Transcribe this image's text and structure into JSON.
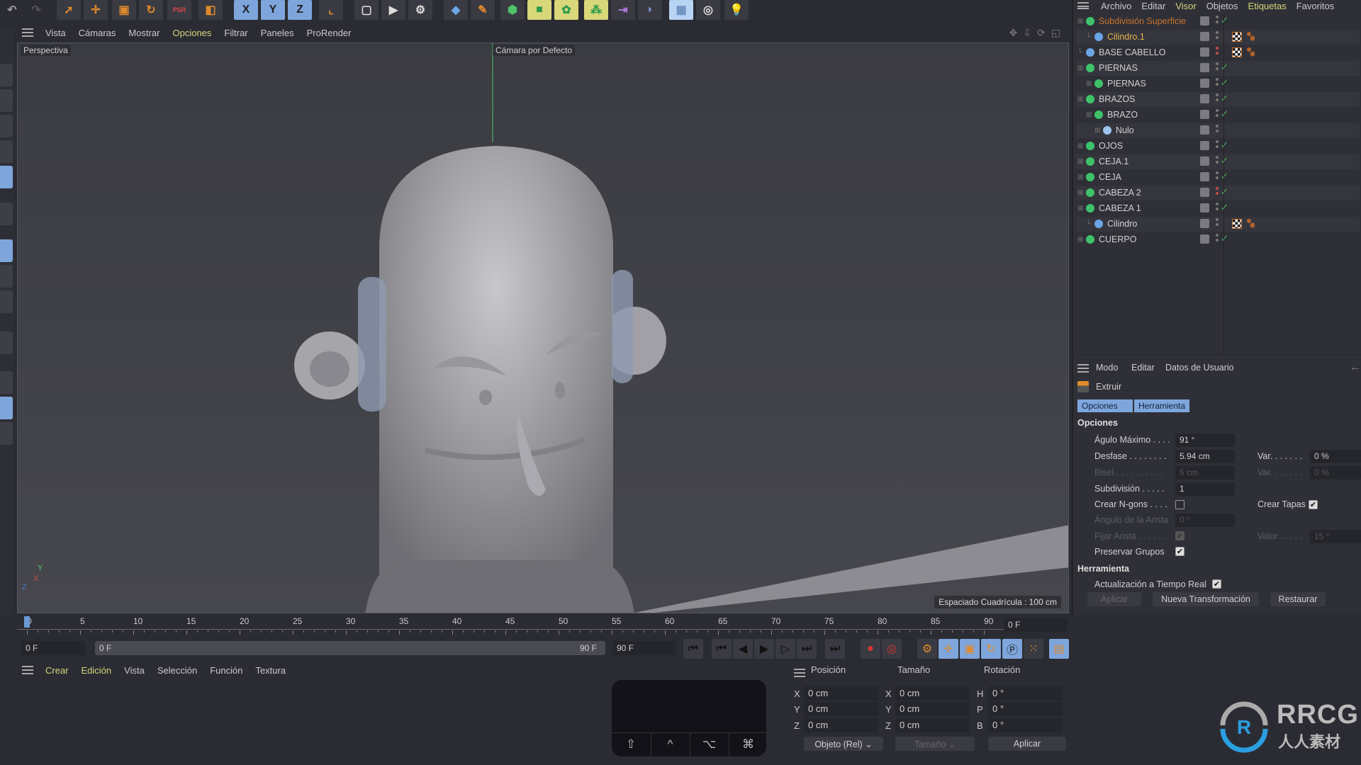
{
  "toolbar": {
    "icons": [
      "undo-icon",
      "redo-icon",
      "live-selection-icon",
      "move-icon",
      "scale-icon",
      "rotate-icon",
      "psr-icon",
      "object-mode-icon",
      "x-axis-lock-icon",
      "y-axis-lock-icon",
      "z-axis-lock-icon",
      "coordinate-system-icon",
      "render-view-icon",
      "render-picture-icon",
      "render-settings-icon",
      "cube-icon",
      "pen-icon",
      "subdivision-icon",
      "extrude-generator-icon",
      "cloner-icon",
      "mograph-icon",
      "deformer-icon",
      "bend-icon",
      "floor-icon",
      "camera-icon",
      "light-icon"
    ],
    "axis_labels": [
      "X",
      "Y",
      "Z"
    ]
  },
  "viewport": {
    "menu": [
      "Vista",
      "Cámaras",
      "Mostrar",
      "Opciones",
      "Filtrar",
      "Paneles",
      "ProRender"
    ],
    "active_menu": "Opciones",
    "view_name": "Perspectiva",
    "camera_name": "Cámara por Defecto",
    "grid_spacing": "Espaciado Cuadrícula : 100 cm",
    "axis": {
      "x": "X",
      "y": "Y",
      "z": "Z"
    }
  },
  "timeline": {
    "ticks": [
      "0",
      "5",
      "10",
      "15",
      "20",
      "25",
      "30",
      "35",
      "40",
      "45",
      "50",
      "55",
      "60",
      "65",
      "70",
      "75",
      "80",
      "85",
      "90"
    ],
    "current_frame": "0 F",
    "start_field": "0 F",
    "range_start": "0 F",
    "range_end": "90 F",
    "end_field": "90 F"
  },
  "material_menu": [
    "Crear",
    "Edición",
    "Vista",
    "Selección",
    "Función",
    "Textura"
  ],
  "keypad": {
    "keys": [
      "⇧",
      "^",
      "⌥",
      "⌘"
    ]
  },
  "coords": {
    "headers": [
      "Posición",
      "Tamaño",
      "Rotación"
    ],
    "position": [
      {
        "axis": "X",
        "value": "0 cm"
      },
      {
        "axis": "Y",
        "value": "0 cm"
      },
      {
        "axis": "Z",
        "value": "0 cm"
      }
    ],
    "size": [
      {
        "axis": "X",
        "value": "0 cm"
      },
      {
        "axis": "Y",
        "value": "0 cm"
      },
      {
        "axis": "Z",
        "value": "0 cm"
      }
    ],
    "rotation": [
      {
        "axis": "H",
        "value": "0 °"
      },
      {
        "axis": "P",
        "value": "0 °"
      },
      {
        "axis": "B",
        "value": "0 °"
      }
    ],
    "mode_select": "Objeto (Rel)",
    "size_select": "Tamaño",
    "apply": "Aplicar"
  },
  "object_manager": {
    "menu": [
      "Archivo",
      "Editar",
      "Visor",
      "Objetos",
      "Etiquetas",
      "Favoritos"
    ],
    "objects": [
      {
        "name": "Subdivisión Superficie",
        "indent": 0,
        "type": "generator",
        "color": "#c8732c",
        "check": true,
        "red": false,
        "tags": false
      },
      {
        "name": "Cilindro.1",
        "indent": 1,
        "type": "polygon",
        "color": "#e7b04a",
        "check": false,
        "red": false,
        "tags": true
      },
      {
        "name": "BASE CABELLO",
        "indent": 0,
        "type": "polygon",
        "color": "#d0d0d0",
        "check": false,
        "red": true,
        "tags": true
      },
      {
        "name": "PIERNAS",
        "indent": 0,
        "type": "symmetry",
        "color": "#d0d0d0",
        "check": true,
        "red": false,
        "tags": false
      },
      {
        "name": "PIERNAS",
        "indent": 1,
        "type": "generator",
        "color": "#d0d0d0",
        "check": true,
        "red": false,
        "tags": false
      },
      {
        "name": "BRAZOS",
        "indent": 0,
        "type": "symmetry",
        "color": "#d0d0d0",
        "check": true,
        "red": false,
        "tags": false
      },
      {
        "name": "BRAZO",
        "indent": 1,
        "type": "generator",
        "color": "#d0d0d0",
        "check": true,
        "red": false,
        "tags": false
      },
      {
        "name": "Nulo",
        "indent": 2,
        "type": "null",
        "color": "#d0d0d0",
        "check": false,
        "red": false,
        "tags": false
      },
      {
        "name": "OJOS",
        "indent": 0,
        "type": "symmetry",
        "color": "#d0d0d0",
        "check": true,
        "red": false,
        "tags": false
      },
      {
        "name": "CEJA.1",
        "indent": 0,
        "type": "generator",
        "color": "#d0d0d0",
        "check": true,
        "red": false,
        "tags": false
      },
      {
        "name": "CEJA",
        "indent": 0,
        "type": "generator",
        "color": "#d0d0d0",
        "check": true,
        "red": false,
        "tags": false
      },
      {
        "name": "CABEZA 2",
        "indent": 0,
        "type": "generator",
        "color": "#d0d0d0",
        "check": true,
        "red": true,
        "tags": false
      },
      {
        "name": "CABEZA 1",
        "indent": 0,
        "type": "generator",
        "color": "#d0d0d0",
        "check": true,
        "red": false,
        "tags": false
      },
      {
        "name": "Cilindro",
        "indent": 1,
        "type": "polygon",
        "color": "#d0d0d0",
        "check": false,
        "red": false,
        "tags": true
      },
      {
        "name": "CUERPO",
        "indent": 0,
        "type": "generator",
        "color": "#d0d0d0",
        "check": true,
        "red": false,
        "tags": false
      }
    ]
  },
  "attributes": {
    "menu": [
      "Modo",
      "Editar",
      "Datos de Usuario"
    ],
    "tool_name": "Extruir",
    "tabs": [
      "Opciones",
      "Herramienta"
    ],
    "section_options": "Opciones",
    "fields": {
      "angulo_maximo": {
        "label": "Águlo Máximo . . . .",
        "value": "91 °"
      },
      "desfase": {
        "label": "Desfase . . . . . . . .",
        "value": "5.94 cm"
      },
      "desfase_var": {
        "label": "Var. . . . . . .",
        "value": "0 %"
      },
      "bisel": {
        "label": "Bisel . . . . . . . . . .",
        "value": "5 cm"
      },
      "bisel_var": {
        "label": "Var. . . . . . .",
        "value": "0 %"
      },
      "subdivision": {
        "label": "Subdivisión . . . . .",
        "value": "1"
      },
      "crear_ngons": {
        "label": "Crear N-gons . . . .",
        "checked": false
      },
      "crear_tapas": {
        "label": "Crear Tapas",
        "checked": true
      },
      "angulo_arista": {
        "label": "Ángulo de la Arista",
        "value": "0 °"
      },
      "fijar_arista": {
        "label": "Fijar Arista . . . . . .",
        "checked": true
      },
      "valor": {
        "label": "Valor . . . . .",
        "value": "15 °"
      },
      "preservar_grupos": {
        "label": "Preservar Grupos",
        "checked": true
      }
    },
    "section_tool": "Herramienta",
    "realtime": {
      "label": "Actualización a Tiempo Real",
      "checked": true
    },
    "buttons": {
      "apply": "Aplicar",
      "new_transform": "Nueva Transformación",
      "reset": "Restaurar"
    }
  },
  "watermark": {
    "brand": "RRCG",
    "sub": "人人素材"
  }
}
